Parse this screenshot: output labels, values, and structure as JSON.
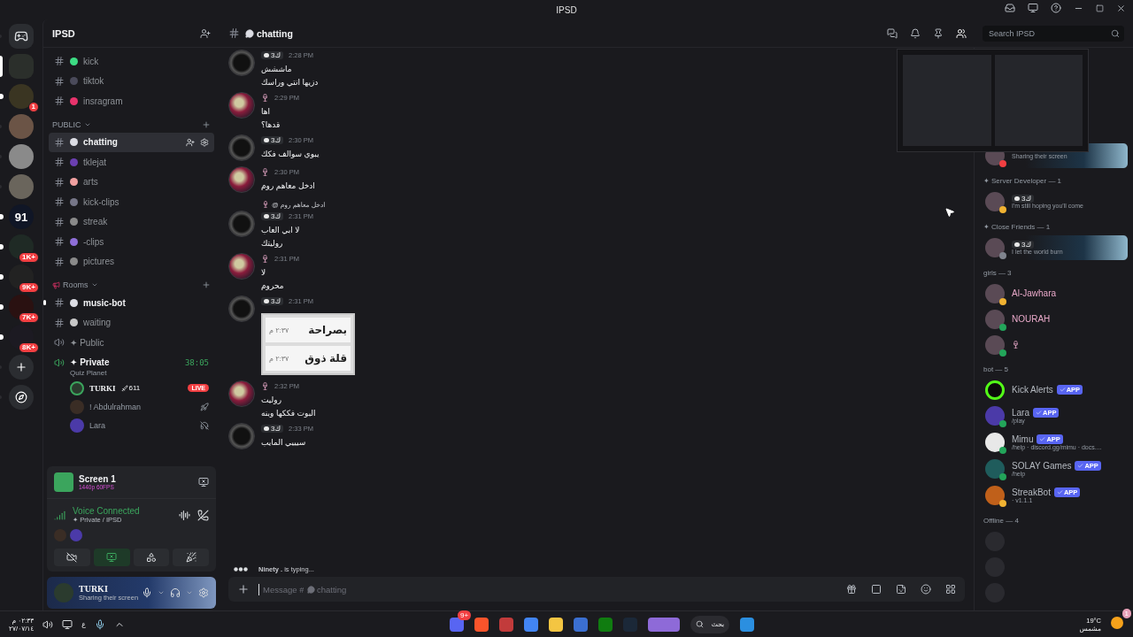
{
  "window": {
    "title": "IPSD"
  },
  "servers": [
    {
      "kind": "home",
      "selected": false,
      "unread": false
    },
    {
      "kind": "server",
      "selected": true,
      "unread": false,
      "color": "#2b2f2b"
    },
    {
      "kind": "server",
      "selected": false,
      "unread": true,
      "badge": "1",
      "color": "#3a3522"
    },
    {
      "kind": "server",
      "selected": false,
      "unread": false,
      "color": "#6b5446"
    },
    {
      "kind": "server",
      "selected": false,
      "unread": false,
      "color": "#8a8a8a"
    },
    {
      "kind": "server",
      "selected": false,
      "unread": false,
      "color": "#6a655c"
    },
    {
      "kind": "server",
      "selected": false,
      "unread": true,
      "label": "91",
      "color": "#101626"
    },
    {
      "kind": "server",
      "selected": false,
      "unread": true,
      "badge": "1K+",
      "color": "#1f2a25"
    },
    {
      "kind": "server",
      "selected": false,
      "unread": true,
      "badge": "9K+",
      "color": "#222222"
    },
    {
      "kind": "server",
      "selected": false,
      "unread": true,
      "badge": "7K+",
      "color": "#2a1111"
    },
    {
      "kind": "server",
      "selected": false,
      "unread": true,
      "badge": "8K+",
      "color": "#1c1a22"
    },
    {
      "kind": "add",
      "selected": false,
      "unread": false
    },
    {
      "kind": "discover",
      "selected": false,
      "unread": false
    }
  ],
  "server_name": "IPSD",
  "channel_groups": [
    {
      "items": [
        {
          "kind": "text",
          "name": "kick",
          "color": "#3ddc84",
          "selected": false,
          "unread": false
        },
        {
          "kind": "text",
          "name": "tiktok",
          "color": "#4a4a5a",
          "selected": false,
          "unread": false
        },
        {
          "kind": "text",
          "name": "insragram",
          "color": "#e8336c",
          "selected": false,
          "unread": false
        }
      ]
    },
    {
      "title": "PUBLIC",
      "items": [
        {
          "kind": "text",
          "name": "chatting",
          "color": "#dcdde4",
          "selected": true,
          "unread": true
        },
        {
          "kind": "text",
          "name": "tklejat",
          "color": "#6a3fb0",
          "selected": false,
          "unread": false
        },
        {
          "kind": "text",
          "name": "arts",
          "color": "#f0a0a0",
          "selected": false,
          "unread": false
        },
        {
          "kind": "text",
          "name": "kick-clips",
          "color": "#767688",
          "selected": false,
          "unread": false
        },
        {
          "kind": "text",
          "name": "streak",
          "color": "#8a8a8a",
          "selected": false,
          "unread": false
        },
        {
          "kind": "text",
          "name": "-clips",
          "color": "#8f6fd8",
          "selected": false,
          "unread": false
        },
        {
          "kind": "text",
          "name": "pictures",
          "color": "#8a8a8a",
          "selected": false,
          "unread": false
        }
      ]
    },
    {
      "title": "Rooms",
      "items": [
        {
          "kind": "text",
          "name": "music-bot",
          "color": "#dcdde4",
          "selected": false,
          "unread": true
        },
        {
          "kind": "text",
          "name": "waiting",
          "color": "#c8c8c8",
          "selected": false,
          "unread": false
        },
        {
          "kind": "voice",
          "name": "✦ Public",
          "selected": false,
          "unread": false,
          "connected": false
        },
        {
          "kind": "voice",
          "name": "✦ Private",
          "selected": false,
          "unread": true,
          "connected": true,
          "timer": "38:05",
          "activity": "Quiz Planet",
          "users": [
            {
              "kind": "live",
              "name": "TURKI",
              "extra": "611",
              "live_text": "LIVE"
            },
            {
              "kind": "rocket",
              "name": "! Abdulrahman"
            },
            {
              "kind": "deafened",
              "name": "Lara"
            }
          ]
        }
      ]
    }
  ],
  "stream": {
    "title": "Screen 1",
    "quality": "1440p 60FPS"
  },
  "voice": {
    "status": "Voice Connected",
    "channel": "✦ Private / IPSD",
    "controls": [
      {
        "kind": "camera",
        "active": false
      },
      {
        "kind": "screen",
        "active": true
      },
      {
        "kind": "activities",
        "active": false
      },
      {
        "kind": "soundboard",
        "active": false
      }
    ]
  },
  "user": {
    "name": "TURKI",
    "activity": "Sharing their screen"
  },
  "channel_header": {
    "name": "chatting",
    "search": {
      "placeholder": "Search IPSD"
    },
    "tools": [
      {
        "kind": "threads",
        "selected": false
      },
      {
        "kind": "bell",
        "selected": false
      },
      {
        "kind": "pin",
        "selected": false
      },
      {
        "kind": "members",
        "selected": true
      }
    ]
  },
  "messages": [
    {
      "kind": "text",
      "tag": "ك3",
      "time": "2:28 PM",
      "lines": [
        "ماششش",
        "دزيها انتي وراسك"
      ]
    },
    {
      "kind": "text",
      "glyph": true,
      "time": "2:29 PM",
      "lines": [
        "اها",
        "قدها؟"
      ]
    },
    {
      "kind": "text",
      "tag": "ك3",
      "time": "2:30 PM",
      "lines": [
        "يبوي سوالف فكك"
      ]
    },
    {
      "kind": "text",
      "glyph": true,
      "time": "2:30 PM",
      "lines": [
        "ادخل معاهم روم"
      ]
    },
    {
      "kind": "text",
      "tag": "ك3",
      "time": "2:31 PM",
      "reply": {
        "mention": "@",
        "text": "ادخل معاهم روم"
      },
      "lines": [
        "لا ابي العاب",
        "روليتك"
      ]
    },
    {
      "kind": "text",
      "glyph": true,
      "time": "2:31 PM",
      "lines": [
        "لا",
        "محروم"
      ]
    },
    {
      "kind": "image",
      "tag": "ك3",
      "time": "2:31 PM",
      "image_rows": [
        {
          "text": "بصراحة",
          "time": "٢:٣٧ م"
        },
        {
          "text": "قلة ذوق",
          "time": "٢:٣٧ م"
        }
      ]
    },
    {
      "kind": "text",
      "glyph": true,
      "time": "2:32 PM",
      "lines": [
        "روليت",
        "البوت فككها وبنه"
      ]
    },
    {
      "kind": "text",
      "tag": "ك3",
      "time": "2:33 PM",
      "lines": [
        "سيييي المايب"
      ]
    }
  ],
  "typing": "**Ninety .** is typing...",
  "composer": {
    "placeholder": "Message #",
    "channel": "chatting"
  },
  "members": [
    {
      "items": [
        {
          "kind": "user",
          "banner": true,
          "color": "#f23f42",
          "activity": "Sharing their screen"
        }
      ]
    },
    {
      "title": "✦ Server Developer — 1",
      "items": [
        {
          "kind": "user",
          "banner": false,
          "color": "#f0b232",
          "tag": "ك3",
          "activity": "I'm still hoping you'll come"
        }
      ]
    },
    {
      "title": "✦ Close Friends — 1",
      "items": [
        {
          "kind": "user",
          "banner": true,
          "color": "#80848e",
          "tag": "ك3",
          "activity": "I let the world burn"
        }
      ]
    },
    {
      "title": "girls — 3",
      "items": [
        {
          "kind": "user",
          "name": "Al-Jawhara",
          "color": "#f0b232"
        },
        {
          "kind": "user",
          "name": "NOURAH",
          "color": "#23a55a"
        },
        {
          "kind": "user",
          "glyph": true,
          "color": "#23a55a"
        }
      ]
    },
    {
      "title": "bot — 5",
      "items": [
        {
          "kind": "bot",
          "name": "Kick Alerts",
          "badge": "APP"
        },
        {
          "kind": "bot",
          "name": "Lara",
          "badge": "APP",
          "activity": "/play",
          "color": "#23a55a"
        },
        {
          "kind": "bot",
          "name": "Mimu",
          "badge": "APP",
          "activity": "/help · discord.gg/mimu · docs....",
          "color": "#23a55a"
        },
        {
          "kind": "bot",
          "name": "SOLAY Games",
          "badge": "APP",
          "activity": "/help",
          "color": "#23a55a"
        },
        {
          "kind": "bot",
          "name": "StreakBot",
          "badge": "APP",
          "activity": "· v1.1.1",
          "color": "#f0b232"
        }
      ]
    },
    {
      "title": "Offline — 4",
      "items": [
        {
          "kind": "offline"
        },
        {
          "kind": "offline"
        },
        {
          "kind": "offline"
        }
      ]
    }
  ],
  "taskbar": {
    "time": "٠٢:٣٣ م",
    "date": "٢٧/٠٧/١٤",
    "language": "ع",
    "search": "بحث",
    "weather": {
      "temp": "19°C",
      "text": "مشمس",
      "badge": "1"
    },
    "discord_badge": "9+"
  }
}
